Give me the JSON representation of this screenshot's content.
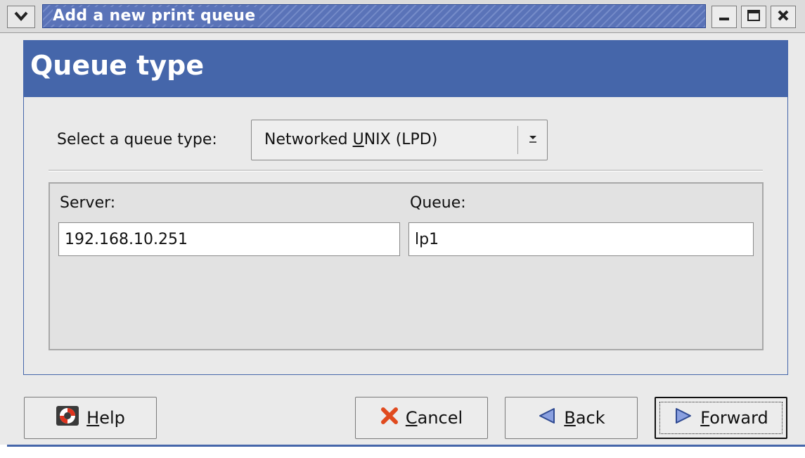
{
  "window": {
    "title": "Add a new print queue",
    "accent": "#4566aa"
  },
  "banner": {
    "title": "Queue type"
  },
  "queue_type": {
    "label": "Select a queue type:",
    "selected_prefix": "Networked ",
    "selected_mnemonic": "U",
    "selected_suffix": "NIX (LPD)"
  },
  "fields": {
    "server_label": "Server:",
    "server_value": "192.168.10.251",
    "queue_label": "Queue:",
    "queue_value": "lp1"
  },
  "buttons": {
    "help": {
      "mnemonic": "H",
      "rest": "elp",
      "icon": "lifebuoy-icon"
    },
    "cancel": {
      "mnemonic": "C",
      "rest": "ancel",
      "icon": "cross-icon"
    },
    "back": {
      "mnemonic": "B",
      "rest": "ack",
      "icon": "left-arrow-icon"
    },
    "forward": {
      "mnemonic": "F",
      "rest": "orward",
      "icon": "right-arrow-icon"
    }
  }
}
